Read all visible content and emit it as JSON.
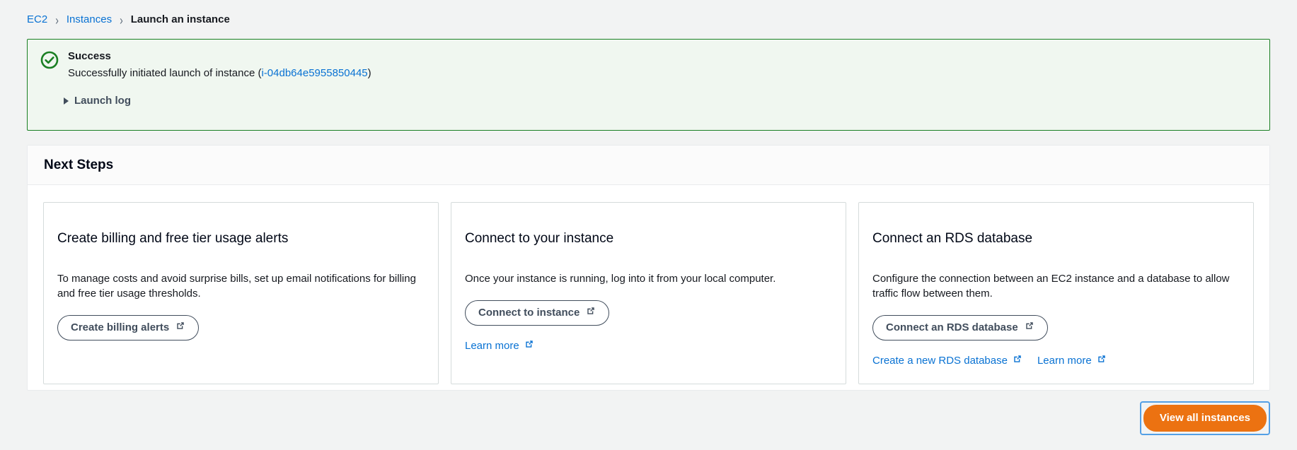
{
  "breadcrumb": {
    "items": [
      {
        "label": "EC2",
        "type": "link"
      },
      {
        "label": "Instances",
        "type": "link"
      },
      {
        "label": "Launch an instance",
        "type": "current"
      }
    ],
    "separator": "›"
  },
  "alert": {
    "icon": "success-check-icon",
    "title": "Success",
    "message_prefix": "Successfully initiated launch of instance (",
    "instance_id": "i-04db64e5955850445",
    "message_suffix": ")",
    "expander_label": "Launch log",
    "expander_icon": "caret-right-icon",
    "border_color": "#1a7f23",
    "background_color": "#f0f7f0"
  },
  "panel": {
    "title": "Next Steps",
    "cards": [
      {
        "title": "Create billing and free tier usage alerts",
        "description": "To manage costs and avoid surprise bills, set up email notifications for billing and free tier usage thresholds.",
        "button": {
          "label": "Create billing alerts",
          "icon": "external-link-icon"
        },
        "links": []
      },
      {
        "title": "Connect to your instance",
        "description": "Once your instance is running, log into it from your local computer.",
        "button": {
          "label": "Connect to instance",
          "icon": "external-link-icon"
        },
        "links": [
          {
            "label": "Learn more",
            "icon": "external-link-icon"
          }
        ]
      },
      {
        "title": "Connect an RDS database",
        "description": "Configure the connection between an EC2 instance and a database to allow traffic flow between them.",
        "button": {
          "label": "Connect an RDS database",
          "icon": "external-link-icon"
        },
        "links": [
          {
            "label": "Create a new RDS database",
            "icon": "external-link-icon"
          },
          {
            "label": "Learn more",
            "icon": "external-link-icon"
          }
        ]
      }
    ]
  },
  "footer": {
    "primary_button": {
      "label": "View all instances",
      "color": "#ec7211",
      "focused": true
    }
  }
}
